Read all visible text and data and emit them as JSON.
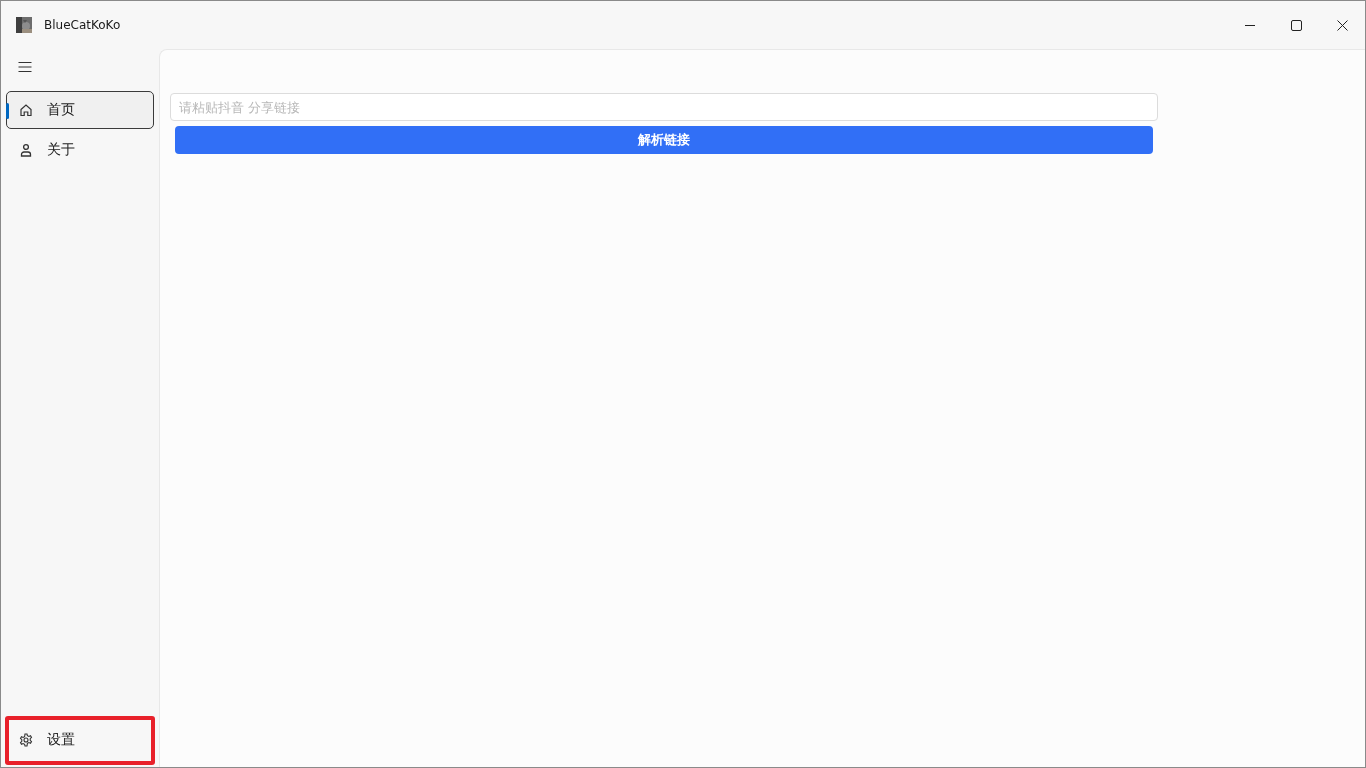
{
  "window": {
    "title": "BlueCatKoKo"
  },
  "sidebar": {
    "items": [
      {
        "label": "首页",
        "kind": "home",
        "selected": true
      },
      {
        "label": "关于",
        "kind": "person",
        "selected": false
      }
    ],
    "footer_items": [
      {
        "label": "设置",
        "kind": "gear",
        "selected": false,
        "highlighted": true
      }
    ]
  },
  "main": {
    "link_field": {
      "placeholder": "请粘贴抖音 分享链接"
    },
    "parse_button": {
      "label": "解析链接"
    }
  }
}
